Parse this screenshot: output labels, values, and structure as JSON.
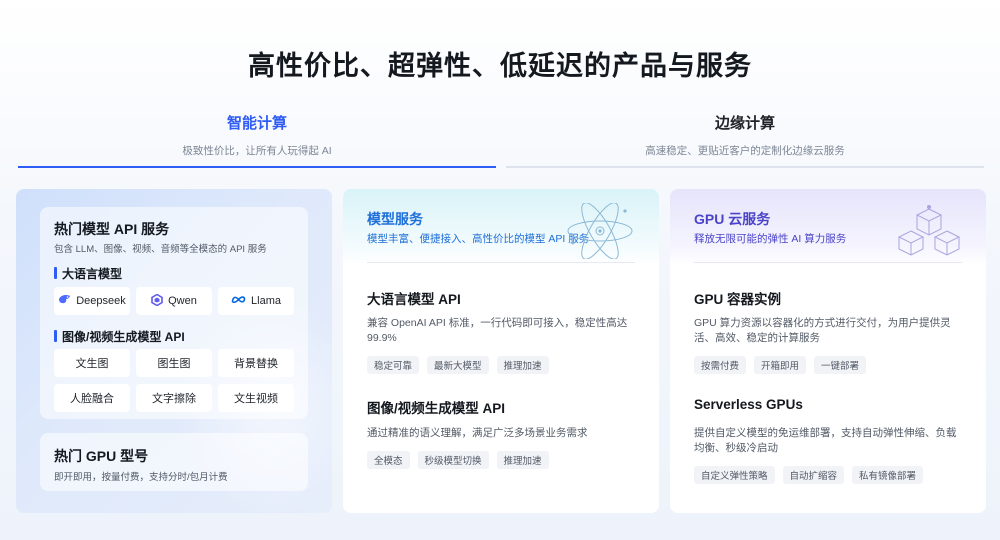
{
  "headline": "高性价比、超弹性、低延迟的产品与服务",
  "tabs": [
    {
      "title": "智能计算",
      "subtitle": "极致性价比，让所有人玩得起 AI"
    },
    {
      "title": "边缘计算",
      "subtitle": "高速稳定、更贴近客户的定制化边缘云服务"
    }
  ],
  "left_panel": {
    "hot_models": {
      "title": "热门模型 API 服务",
      "subtitle": "包含 LLM、图像、视频、音频等全模态的 API 服务",
      "llm_label": "大语言模型",
      "llm_chips": [
        {
          "label": "Deepseek",
          "icon": "deepseek-icon",
          "color": "#4d6bfe"
        },
        {
          "label": "Qwen",
          "icon": "qwen-icon",
          "color": "#615ced"
        },
        {
          "label": "Llama",
          "icon": "meta-icon",
          "color": "#0668e1"
        }
      ],
      "gen_label": "图像/视频生成模型 API",
      "gen_chips": [
        "文生图",
        "图生图",
        "背景替换",
        "人脸融合",
        "文字擦除",
        "文生视频"
      ]
    },
    "hot_gpu": {
      "title": "热门 GPU 型号",
      "subtitle": "即开即用，按量付费，支持分时/包月计费"
    }
  },
  "model_card": {
    "title": "模型服务",
    "subtitle": "模型丰富、便捷接入、高性价比的模型 API 服务",
    "icon": "atom-icon",
    "accent": "#1e6fd9",
    "items": [
      {
        "title": "大语言模型 API",
        "desc": "兼容 OpenAI API 标准，一行代码即可接入，稳定性高达 99.9%",
        "tags": [
          "稳定可靠",
          "最新大模型",
          "推理加速"
        ]
      },
      {
        "title": "图像/视频生成模型 API",
        "desc": "通过精准的语义理解，满足广泛多场景业务需求",
        "tags": [
          "全模态",
          "秒级模型切换",
          "推理加速"
        ]
      }
    ]
  },
  "gpu_card": {
    "title": "GPU 云服务",
    "subtitle": "释放无限可能的弹性 AI 算力服务",
    "icon": "cubes-icon",
    "accent": "#4b44c8",
    "items": [
      {
        "title": "GPU 容器实例",
        "desc": "GPU 算力资源以容器化的方式进行交付，为用户提供灵活、高效、稳定的计算服务",
        "tags": [
          "按需付费",
          "开箱即用",
          "一键部署"
        ]
      },
      {
        "title": "Serverless GPUs",
        "desc": "提供自定义模型的免运维部署，支持自动弹性伸缩、负载均衡、秒级冷启动",
        "tags": [
          "自定义弹性策略",
          "自动扩缩容",
          "私有镜像部署"
        ]
      }
    ]
  }
}
